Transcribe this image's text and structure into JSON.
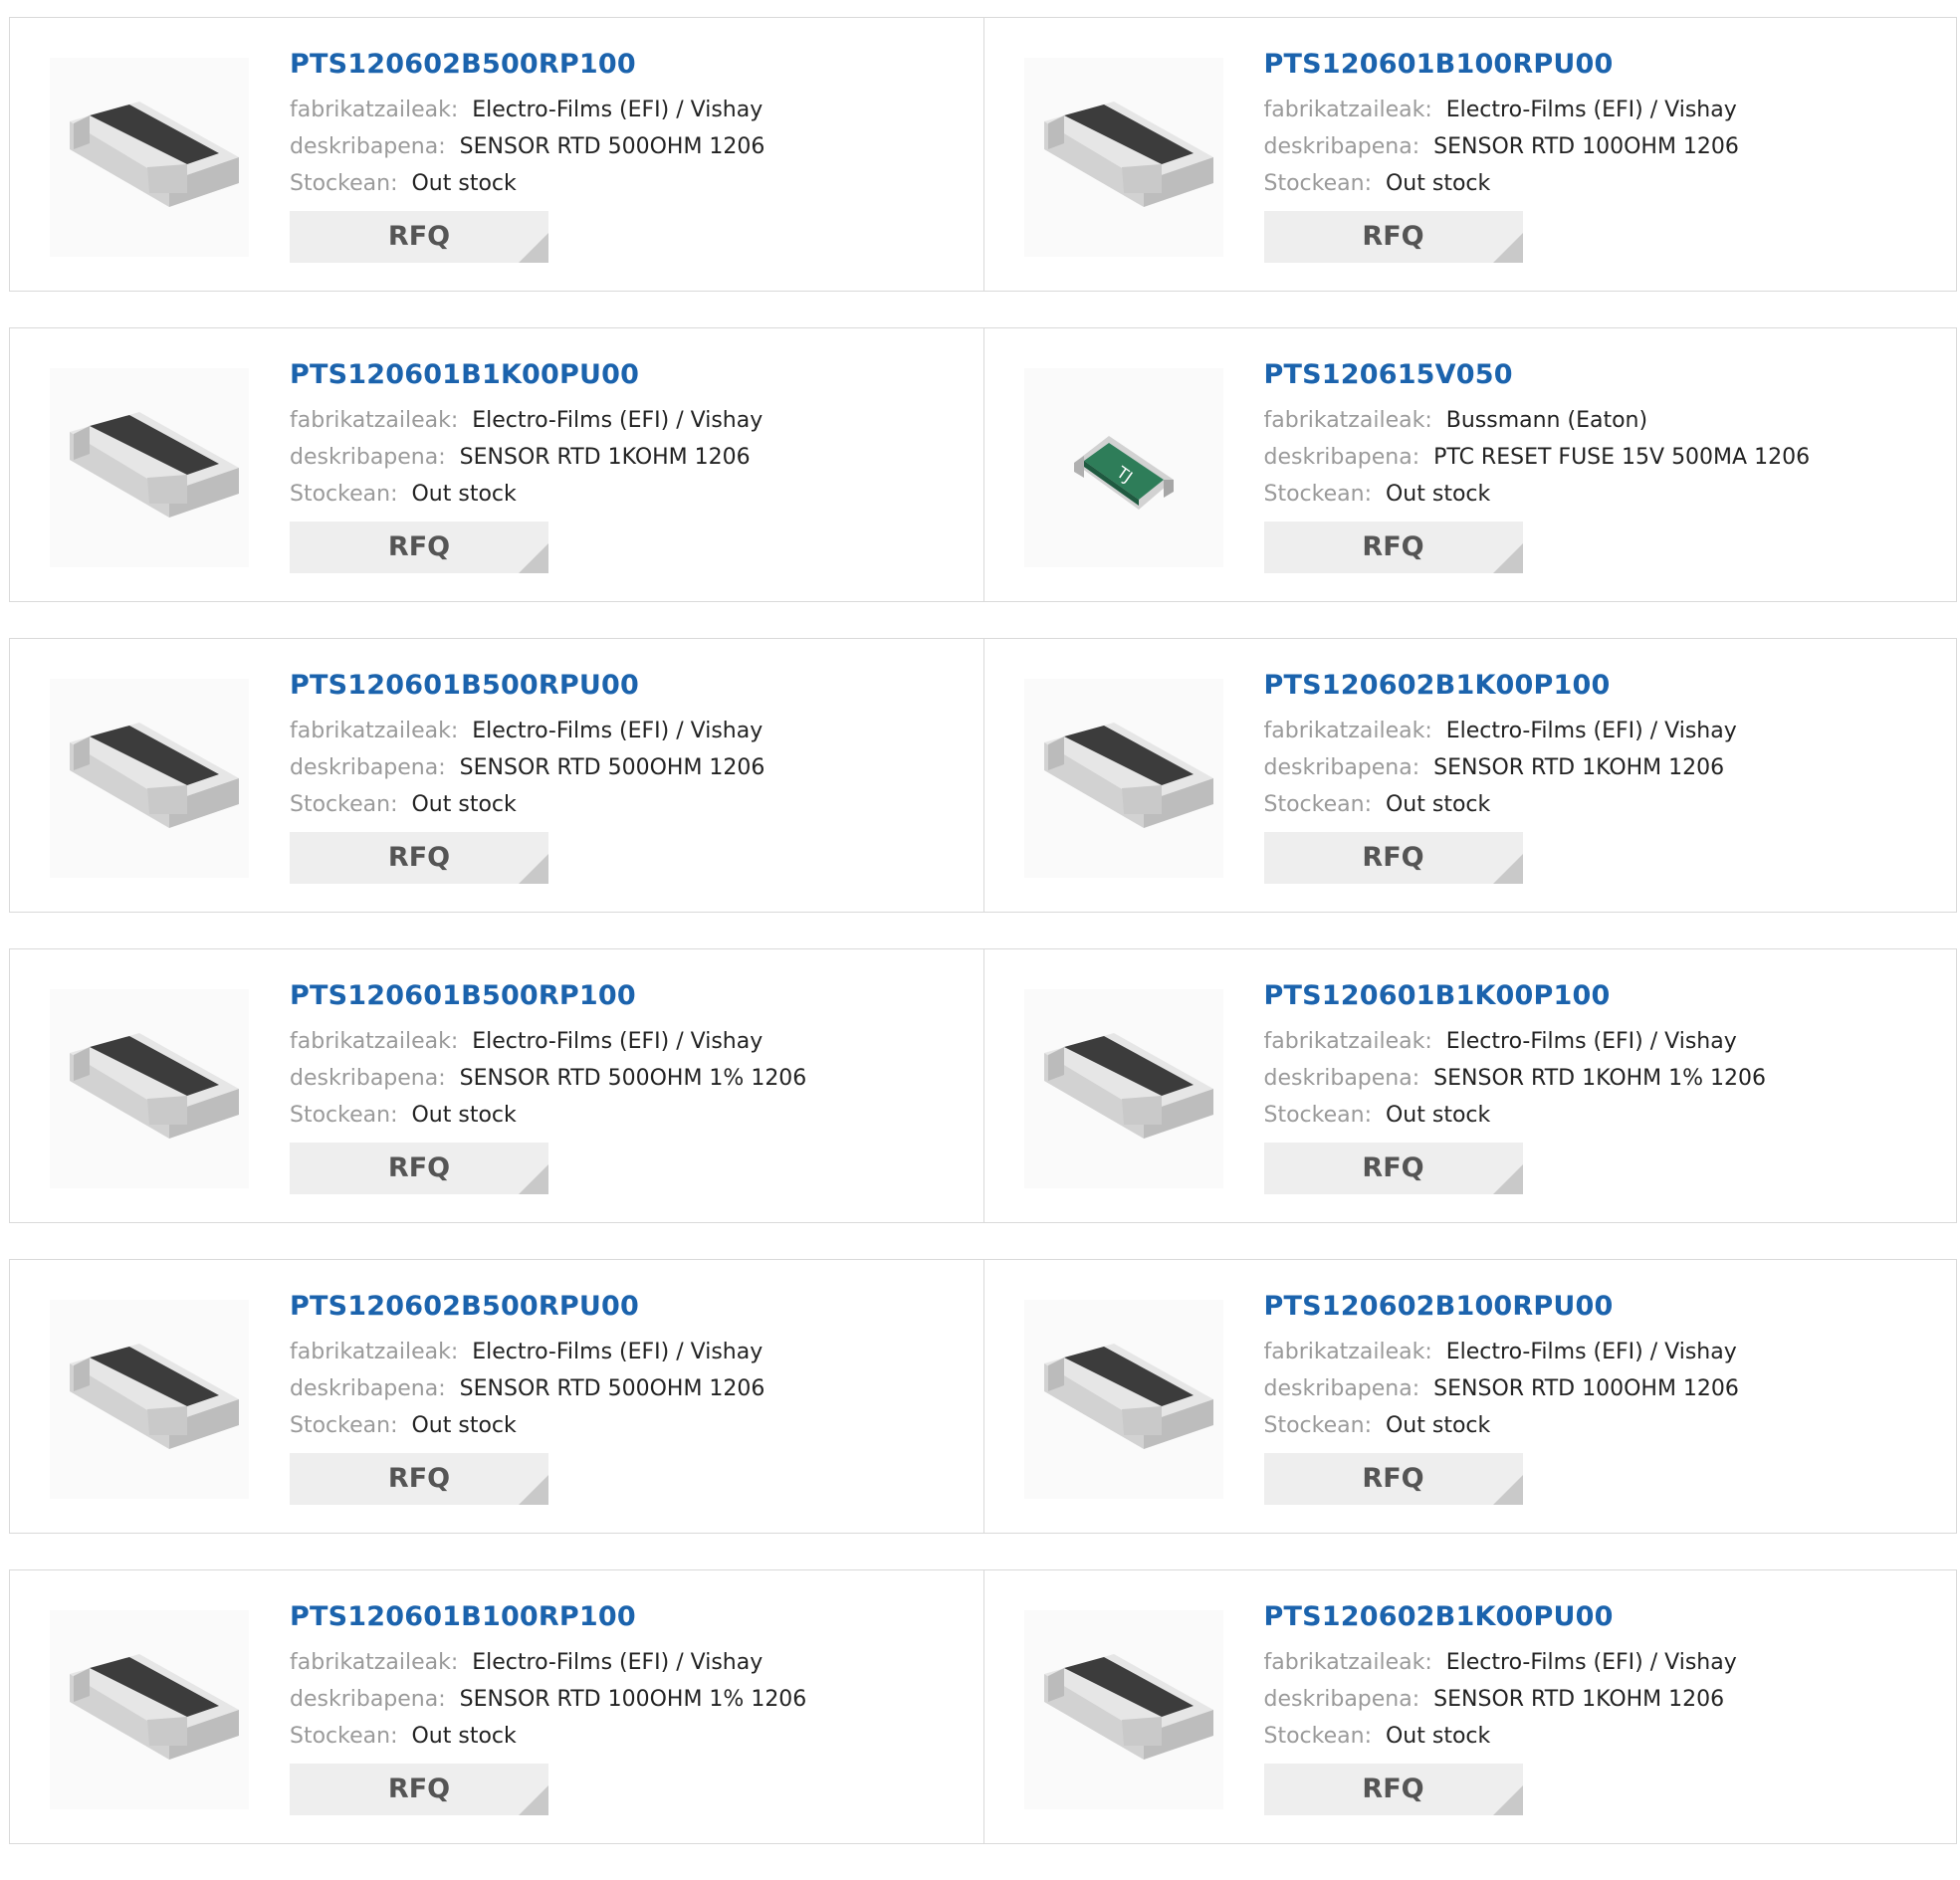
{
  "labels": {
    "manufacturer": "fabrikatzaileak:",
    "description": "deskribapena:",
    "stock": "Stockean:",
    "rfq": "RFQ"
  },
  "products": [
    {
      "part": "PTS120602B500RP100",
      "manufacturer": "Electro-Films (EFI) / Vishay",
      "description": "SENSOR RTD 500OHM 1206",
      "stock": "Out stock",
      "image_icon": "smd-resistor-icon"
    },
    {
      "part": "PTS120601B100RPU00",
      "manufacturer": "Electro-Films (EFI) / Vishay",
      "description": "SENSOR RTD 100OHM 1206",
      "stock": "Out stock",
      "image_icon": "smd-resistor-icon"
    },
    {
      "part": "PTS120601B1K00PU00",
      "manufacturer": "Electro-Films (EFI) / Vishay",
      "description": "SENSOR RTD 1KOHM 1206",
      "stock": "Out stock",
      "image_icon": "smd-resistor-icon"
    },
    {
      "part": "PTS120615V050",
      "manufacturer": "Bussmann (Eaton)",
      "description": "PTC RESET FUSE 15V 500MA 1206",
      "stock": "Out stock",
      "image_icon": "ptc-fuse-icon"
    },
    {
      "part": "PTS120601B500RPU00",
      "manufacturer": "Electro-Films (EFI) / Vishay",
      "description": "SENSOR RTD 500OHM 1206",
      "stock": "Out stock",
      "image_icon": "smd-resistor-icon"
    },
    {
      "part": "PTS120602B1K00P100",
      "manufacturer": "Electro-Films (EFI) / Vishay",
      "description": "SENSOR RTD 1KOHM 1206",
      "stock": "Out stock",
      "image_icon": "smd-resistor-icon"
    },
    {
      "part": "PTS120601B500RP100",
      "manufacturer": "Electro-Films (EFI) / Vishay",
      "description": "SENSOR RTD 500OHM 1% 1206",
      "stock": "Out stock",
      "image_icon": "smd-resistor-icon"
    },
    {
      "part": "PTS120601B1K00P100",
      "manufacturer": "Electro-Films (EFI) / Vishay",
      "description": "SENSOR RTD 1KOHM 1% 1206",
      "stock": "Out stock",
      "image_icon": "smd-resistor-icon"
    },
    {
      "part": "PTS120602B500RPU00",
      "manufacturer": "Electro-Films (EFI) / Vishay",
      "description": "SENSOR RTD 500OHM 1206",
      "stock": "Out stock",
      "image_icon": "smd-resistor-icon"
    },
    {
      "part": "PTS120602B100RPU00",
      "manufacturer": "Electro-Films (EFI) / Vishay",
      "description": "SENSOR RTD 100OHM 1206",
      "stock": "Out stock",
      "image_icon": "smd-resistor-icon"
    },
    {
      "part": "PTS120601B100RP100",
      "manufacturer": "Electro-Films (EFI) / Vishay",
      "description": "SENSOR RTD 100OHM 1% 1206",
      "stock": "Out stock",
      "image_icon": "smd-resistor-icon"
    },
    {
      "part": "PTS120602B1K00PU00",
      "manufacturer": "Electro-Films (EFI) / Vishay",
      "description": "SENSOR RTD 1KOHM 1206",
      "stock": "Out stock",
      "image_icon": "smd-resistor-icon"
    }
  ],
  "fuse_marking": "TJ",
  "colors": {
    "title": "#1b63ad",
    "label": "#9a9a9a",
    "value": "#222222",
    "rfq_bg": "#eeeeee",
    "rfq_text": "#555555",
    "border": "#d9d9d9"
  }
}
